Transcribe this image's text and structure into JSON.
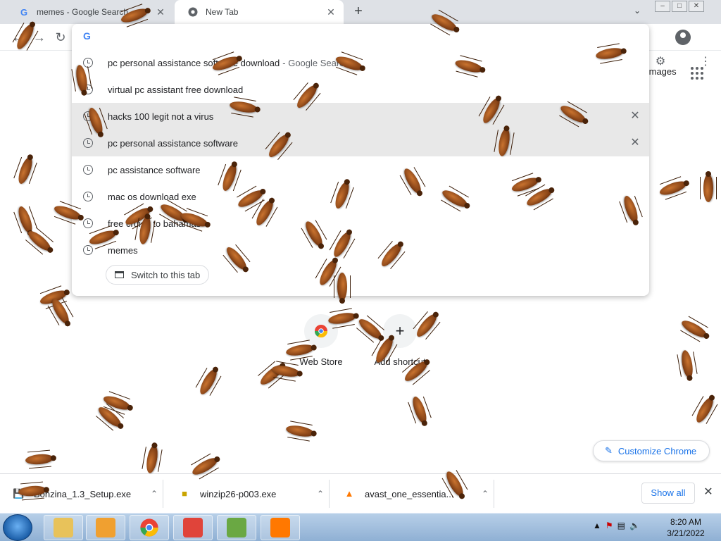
{
  "tabs": [
    {
      "title": "memes - Google Search",
      "favicon": "google-g",
      "close": "✕"
    },
    {
      "title": "New Tab",
      "favicon": "chrome-icon",
      "close": "✕"
    }
  ],
  "new_tab_symbol": "+",
  "toolbar": {
    "omnibox_value": ""
  },
  "suggestions": [
    {
      "text": "pc personal assistance software download",
      "suffix": "- Google Search",
      "highlighted": false,
      "removable": false
    },
    {
      "text": "virtual pc assistant free download",
      "suffix": "",
      "highlighted": false,
      "removable": false
    },
    {
      "text": "hacks 100 legit not a virus",
      "suffix": "",
      "highlighted": true,
      "removable": true
    },
    {
      "text": "pc personal assistance software",
      "suffix": "",
      "highlighted": true,
      "removable": true
    },
    {
      "text": "pc assistance software",
      "suffix": "",
      "highlighted": false,
      "removable": false
    },
    {
      "text": "mac os download exe",
      "suffix": "",
      "highlighted": false,
      "removable": false
    },
    {
      "text": "free cruise to bahamas",
      "suffix": "",
      "highlighted": false,
      "removable": false
    },
    {
      "text": "memes",
      "suffix": "",
      "highlighted": false,
      "removable": false
    }
  ],
  "switch_tab_label": "Switch to this tab",
  "ntp": {
    "images_label": "Images",
    "shortcuts": [
      {
        "label": "Web Store",
        "icon": "chrome-webstore-icon"
      },
      {
        "label": "Add shortcut",
        "icon": "plus-icon",
        "symbol": "+"
      }
    ],
    "customize_label": "Customize Chrome"
  },
  "downloads": [
    {
      "name": "Bonzina_1.3_Setup.exe",
      "icon": "installer-icon"
    },
    {
      "name": "winzip26-p003.exe",
      "icon": "winzip-icon"
    },
    {
      "name": "avast_one_essentia...",
      "icon": "avast-icon"
    }
  ],
  "show_all_label": "Show all",
  "taskbar": {
    "time": "8:20 AM",
    "date": "3/21/2022",
    "apps": [
      "explorer-icon",
      "media-player-icon",
      "chrome-icon",
      "office-icon",
      "network-shield-icon",
      "avast-icon"
    ]
  },
  "colors": {
    "accent": "#1a73e8",
    "tabstrip": "#dee1e6",
    "roach": "#9a4a1a"
  }
}
